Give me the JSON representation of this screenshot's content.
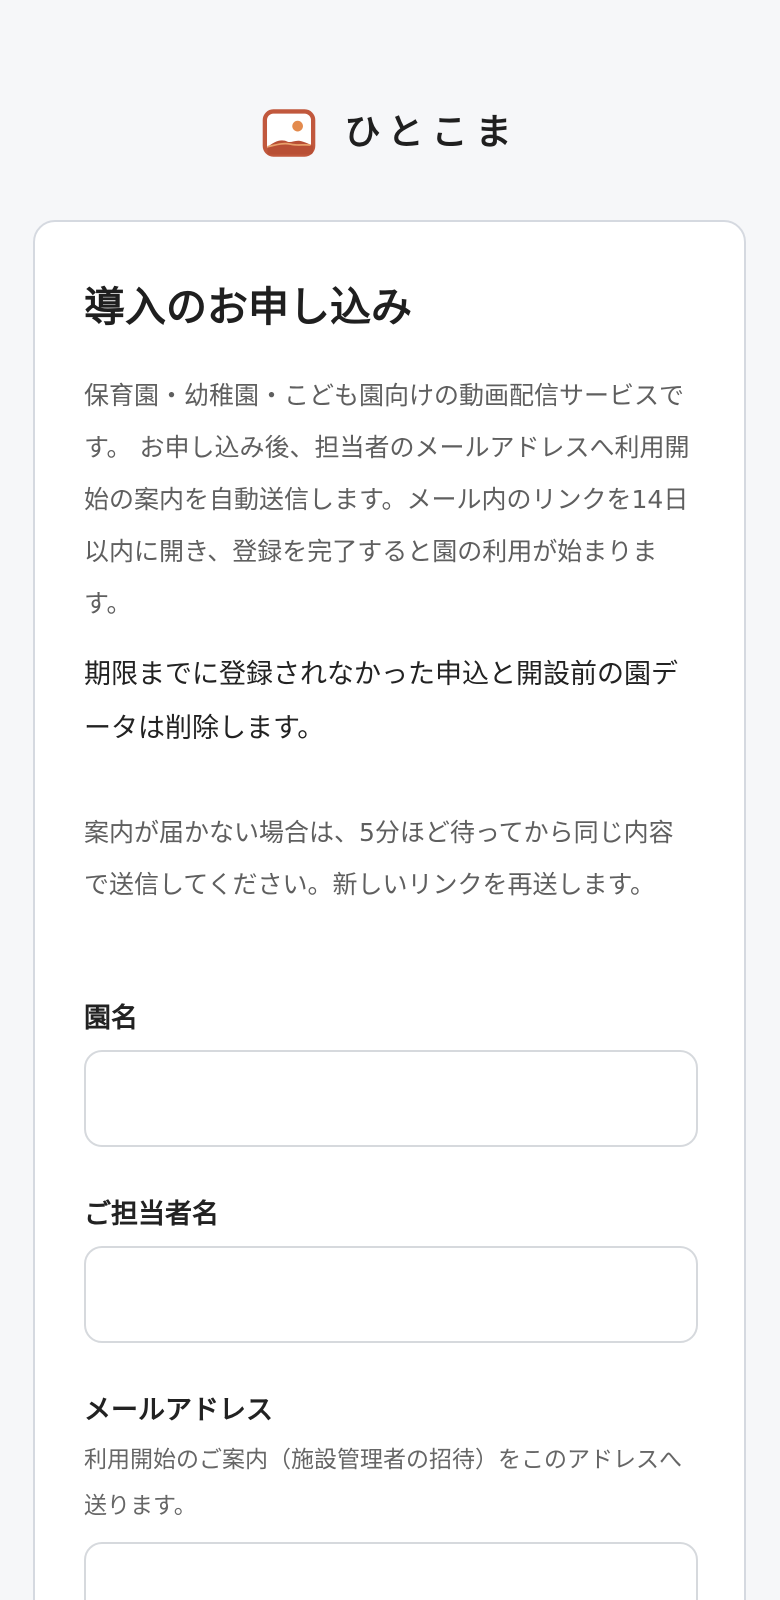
{
  "brand": {
    "name": "ひとこま",
    "logo_icon": "picture-landscape-icon",
    "logo_frame_color": "#c1583d",
    "logo_sun_color": "#e38a4d",
    "logo_hill_color": "#b84f35"
  },
  "form": {
    "title": "導入のお申し込み",
    "intro": "保育園・幼稚園・こども園向けの動画配信サービスです。 お申し込み後、担当者のメールアドレスへ利用開始の案内を自動送信します。メール内のリンクを14日以内に開き、登録を完了すると園の利用が始まります。",
    "notice": "期限までに登録されなかった申込と開設前の園データは削除します。",
    "note": "案内が届かない場合は、5分ほど待ってから同じ内容で送信してください。新しいリンクを再送します。",
    "fields": [
      {
        "label": "園名",
        "value": "",
        "placeholder": ""
      },
      {
        "label": "ご担当者名",
        "value": "",
        "placeholder": ""
      },
      {
        "label": "メールアドレス",
        "help": "利用開始のご案内（施設管理者の招待）をこのアドレスへ送ります。",
        "value": "",
        "placeholder": ""
      }
    ]
  },
  "colors": {
    "page_background": "#f6f7f9",
    "card_background": "#ffffff",
    "card_border": "#d5d9e0",
    "muted_text": "#5f5f5f"
  }
}
